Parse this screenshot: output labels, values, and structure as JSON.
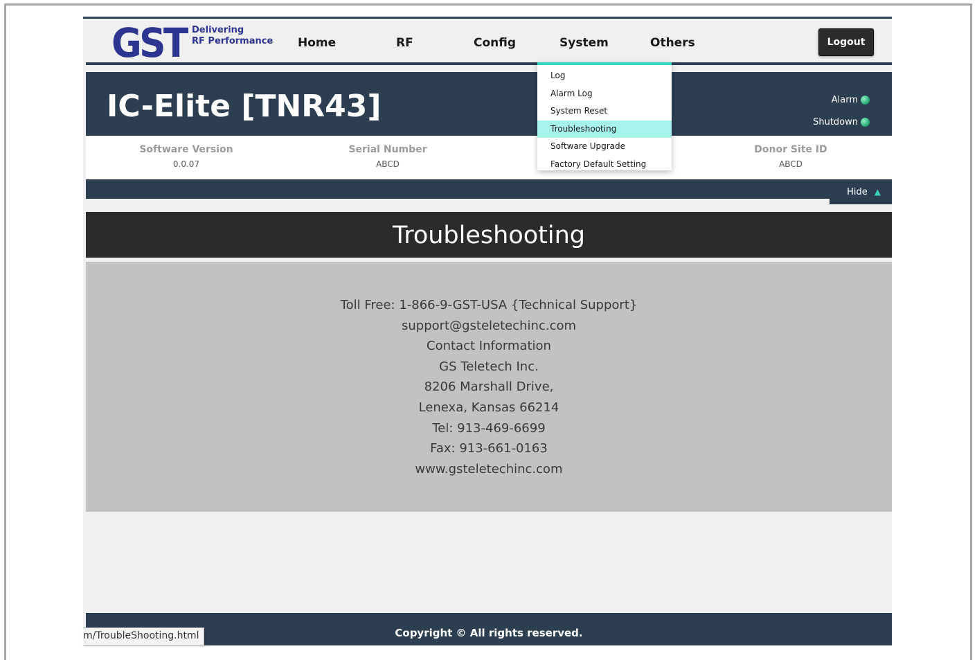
{
  "logo": {
    "mark": "GST",
    "tagline_line1": "Delivering",
    "tagline_line2": "RF Performance"
  },
  "nav": {
    "items": [
      "Home",
      "RF",
      "Config",
      "System",
      "Others"
    ],
    "logout_label": "Logout"
  },
  "system_menu": {
    "items": [
      "Log",
      "Alarm Log",
      "System Reset",
      "Troubleshooting",
      "Software Upgrade",
      "Factory Default Setting"
    ],
    "active": "Troubleshooting"
  },
  "device": {
    "title": "IC-Elite [TNR43]",
    "alarm_label": "Alarm",
    "shutdown_label": "Shutdown"
  },
  "info": {
    "software_version_label": "Software Version",
    "software_version_value": "0.0.07",
    "serial_number_label": "Serial Number",
    "serial_number_value": "ABCD",
    "donor_site_id_label": "Donor Site ID",
    "donor_site_id_value": "ABCD",
    "hide_label": "Hide"
  },
  "section": {
    "title": "Troubleshooting"
  },
  "contact": {
    "lines": [
      "Toll Free: 1-866-9-GST-USA {Technical Support}",
      "support@gsteletechinc.com",
      "Contact Information",
      "GS Teletech Inc.",
      "8206 Marshall Drive,",
      "Lenexa, Kansas 66214",
      "Tel: 913-469-6699",
      "Fax: 913-661-0163",
      "www.gsteletechinc.com"
    ]
  },
  "footer": {
    "copyright": "Copyright © All rights reserved."
  },
  "browser": {
    "status_url": "m/TroubleShooting.html"
  },
  "colors": {
    "navy": "#2c3e50",
    "accent": "#33d6c3",
    "highlight": "#a8f2ec",
    "logo": "#2e3591"
  }
}
